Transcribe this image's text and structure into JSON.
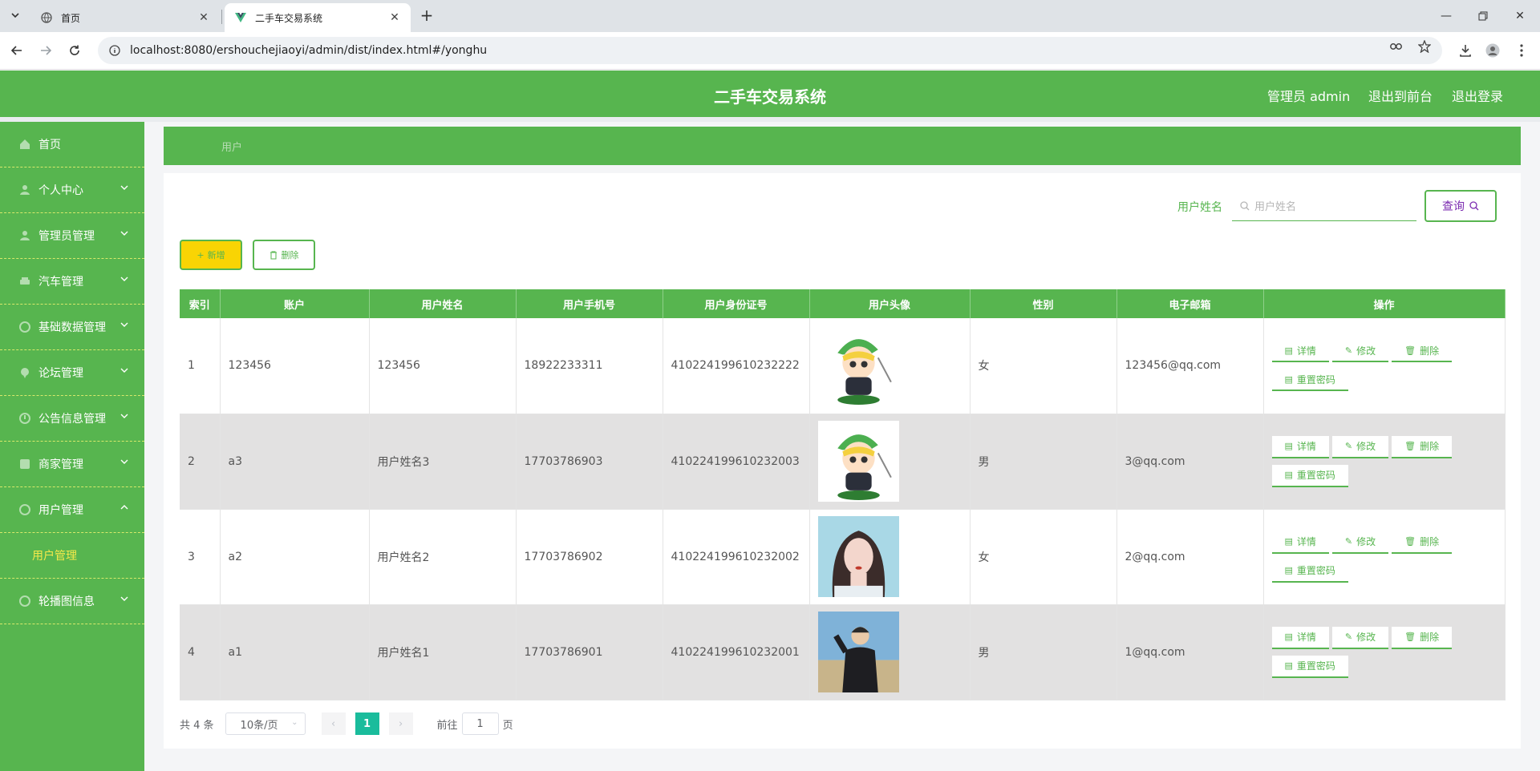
{
  "browser": {
    "tabs": [
      {
        "title": "首页"
      },
      {
        "title": "二手车交易系统"
      }
    ],
    "url": "localhost:8080/ershouchejiaoyi/admin/dist/index.html#/yonghu"
  },
  "header": {
    "title": "二手车交易系统",
    "admin_label": "管理员 admin",
    "front_link": "退出到前台",
    "logout_link": "退出登录"
  },
  "sidebar": {
    "items": [
      {
        "label": "首页",
        "icon": "home-icon"
      },
      {
        "label": "个人中心",
        "icon": "user-icon"
      },
      {
        "label": "管理员管理",
        "icon": "admin-icon"
      },
      {
        "label": "汽车管理",
        "icon": "car-icon"
      },
      {
        "label": "基础数据管理",
        "icon": "data-icon"
      },
      {
        "label": "论坛管理",
        "icon": "forum-icon"
      },
      {
        "label": "公告信息管理",
        "icon": "notice-icon"
      },
      {
        "label": "商家管理",
        "icon": "shop-icon"
      },
      {
        "label": "用户管理",
        "icon": "users-icon"
      },
      {
        "label": "轮播图信息",
        "icon": "carousel-icon"
      }
    ],
    "sub_item": "用户管理"
  },
  "breadcrumb": "用户",
  "search": {
    "label": "用户姓名",
    "placeholder": "用户姓名",
    "button": "查询"
  },
  "actions": {
    "add": "新增",
    "delete": "删除"
  },
  "table": {
    "headers": [
      "索引",
      "账户",
      "用户姓名",
      "用户手机号",
      "用户身份证号",
      "用户头像",
      "性别",
      "电子邮箱",
      "操作"
    ],
    "rows": [
      {
        "index": "1",
        "account": "123456",
        "name": "123456",
        "phone": "18922233311",
        "idcard": "410224199610232222",
        "avatar": "cartoon-avatar",
        "gender": "女",
        "email": "123456@qq.com"
      },
      {
        "index": "2",
        "account": "a3",
        "name": "用户姓名3",
        "phone": "17703786903",
        "idcard": "410224199610232003",
        "avatar": "cartoon-avatar",
        "gender": "男",
        "email": "3@qq.com"
      },
      {
        "index": "3",
        "account": "a2",
        "name": "用户姓名2",
        "phone": "17703786902",
        "idcard": "410224199610232002",
        "avatar": "girl-photo",
        "gender": "女",
        "email": "2@qq.com"
      },
      {
        "index": "4",
        "account": "a1",
        "name": "用户姓名1",
        "phone": "17703786901",
        "idcard": "410224199610232001",
        "avatar": "man-photo",
        "gender": "男",
        "email": "1@qq.com"
      }
    ],
    "row_actions": {
      "detail": "详情",
      "edit": "修改",
      "delete": "删除",
      "reset": "重置密码"
    }
  },
  "pagination": {
    "total": "共 4 条",
    "page_size": "10条/页",
    "current": "1",
    "goto_prefix": "前往",
    "goto_value": "1",
    "goto_suffix": "页"
  },
  "colors": {
    "primary": "#57b54f",
    "add_button": "#f9d404",
    "submenu_text": "#f5e94a",
    "pager_active": "#1abc9c"
  }
}
